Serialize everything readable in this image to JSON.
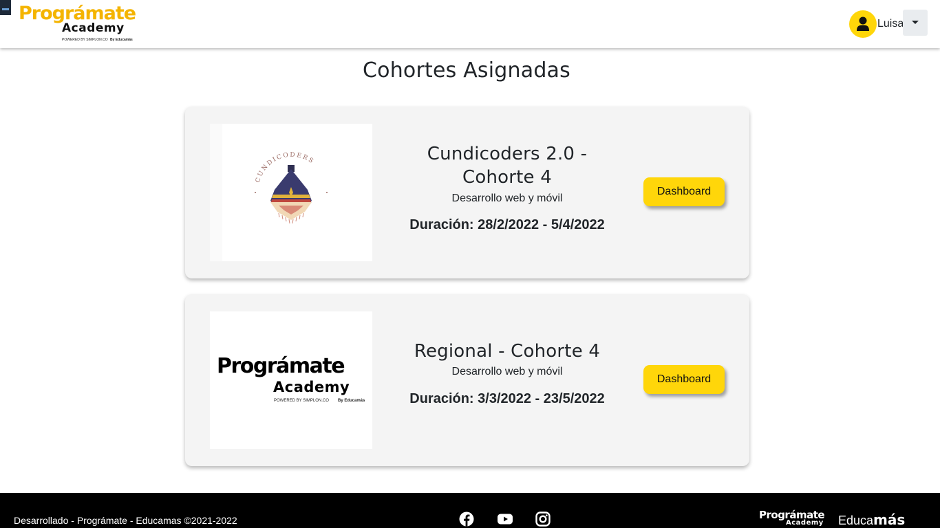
{
  "header": {
    "logo": {
      "main": "Prográmate",
      "sub": "Academy",
      "powered": "POWERED BY SIMPLON.CO",
      "by": "By Educamás"
    },
    "user_name": "Luisa"
  },
  "page_title": "Cohortes Asignadas",
  "cohorts": [
    {
      "name": "Cundicoders 2.0 - Cohorte 4",
      "program": "Desarrollo web y móvil",
      "duration": "Duración: 28/2/2022 - 5/4/2022",
      "button_label": "Dashboard",
      "image_text": "CUNDICODERS"
    },
    {
      "name": "Regional - Cohorte 4",
      "program": "Desarrollo web y móvil",
      "duration": "Duración: 3/3/2022 - 23/5/2022",
      "button_label": "Dashboard",
      "image_logo": {
        "main": "Prográmate",
        "sub": "Academy",
        "powered": "POWERED BY SIMPLON.CO",
        "by": "By Educamás"
      }
    }
  ],
  "footer": {
    "text": "Desarrollado - Prográmate - Educamas ©2021-2022",
    "social_icons": [
      "facebook-icon",
      "youtube-icon",
      "instagram-icon"
    ],
    "logo1_main": "Prográmate",
    "logo1_sub": "Academy",
    "logo2_light": "Educa",
    "logo2_bold": "más"
  },
  "colors": {
    "accent": "#ffd60a",
    "brand_yellow": "#f4b400",
    "card_bg": "#f4f4f4",
    "footer_bg": "#000000"
  }
}
